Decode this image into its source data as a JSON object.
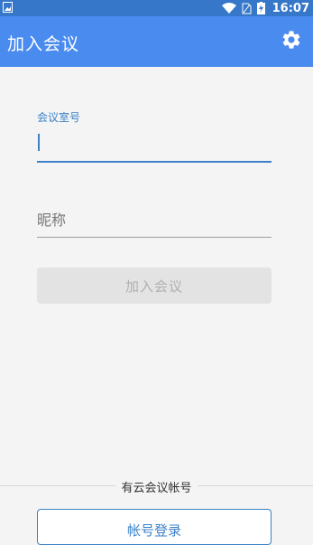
{
  "status_bar": {
    "time": "16:07",
    "icons": [
      "image-icon",
      "wifi-icon",
      "sim-icon",
      "battery-charging-icon"
    ]
  },
  "app_bar": {
    "title": "加入会议",
    "settings_icon": "gear-icon",
    "background": "#4a8bf0"
  },
  "form": {
    "room_label": "会议室号",
    "room_value": "",
    "nickname_placeholder": "昵称",
    "nickname_value": "",
    "join_button": "加入会议"
  },
  "footer": {
    "account_text": "有云会议帐号",
    "login_button": "帐号登录"
  },
  "colors": {
    "accent": "#3b82c8",
    "disabled_bg": "#e3e3e3"
  }
}
